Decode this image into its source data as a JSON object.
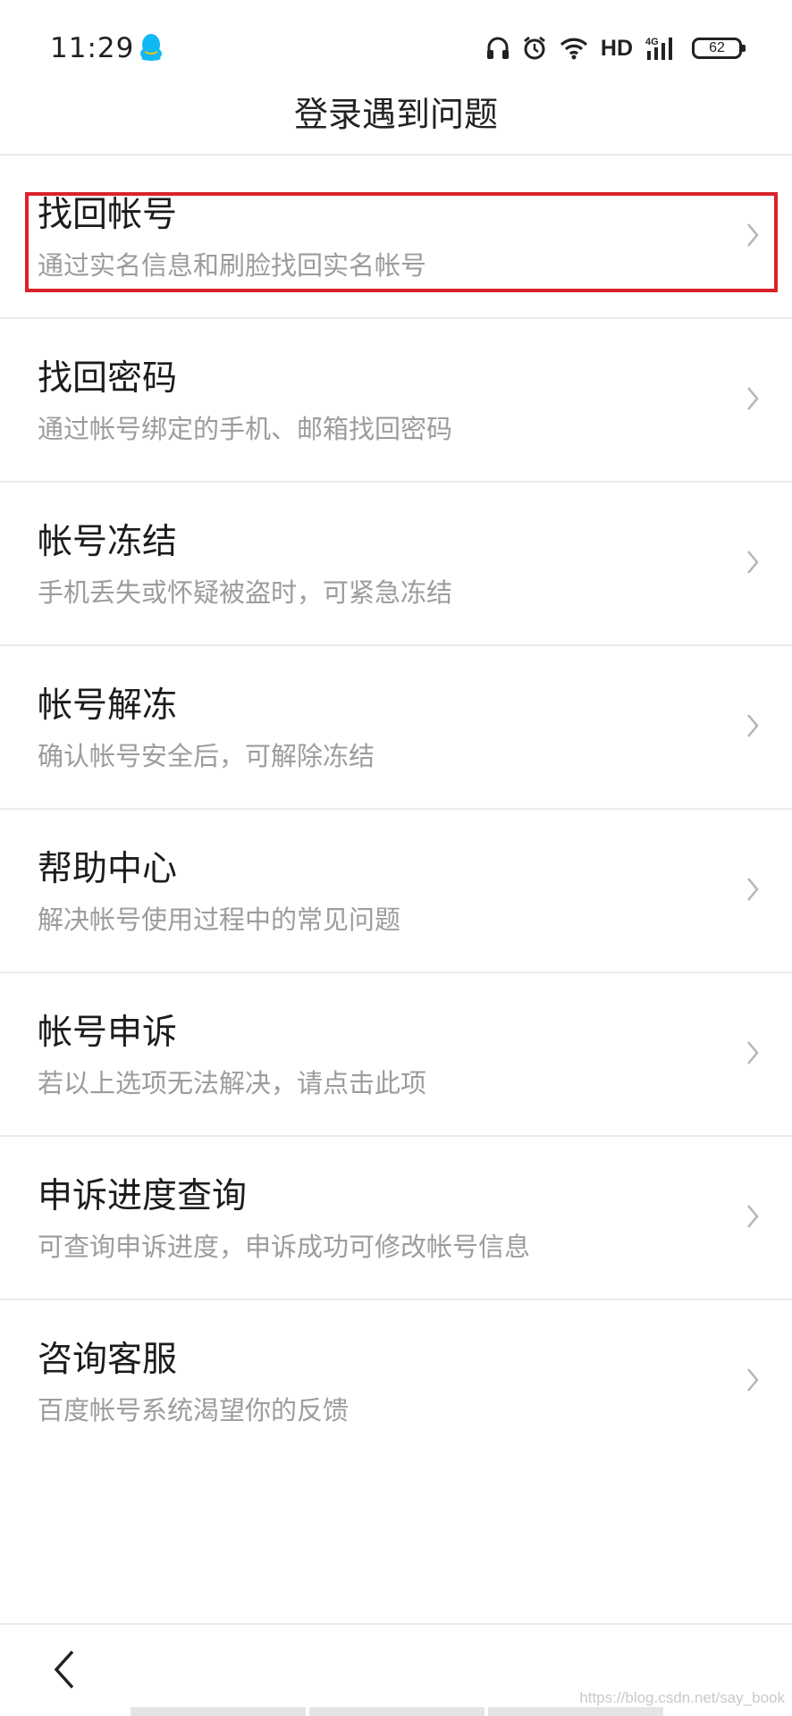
{
  "status_bar": {
    "time": "11:29",
    "network_label": "HD",
    "cellular_label": "4G",
    "battery_level": "62",
    "icons": [
      "qq-icon",
      "headphone-icon",
      "alarm-icon",
      "wifi-icon",
      "signal-icon",
      "battery-icon"
    ]
  },
  "header": {
    "title": "登录遇到问题"
  },
  "menu": {
    "items": [
      {
        "title": "找回帐号",
        "subtitle": "通过实名信息和刷脸找回实名帐号",
        "highlighted": true
      },
      {
        "title": "找回密码",
        "subtitle": "通过帐号绑定的手机、邮箱找回密码"
      },
      {
        "title": "帐号冻结",
        "subtitle": "手机丢失或怀疑被盗时，可紧急冻结"
      },
      {
        "title": "帐号解冻",
        "subtitle": "确认帐号安全后，可解除冻结"
      },
      {
        "title": "帮助中心",
        "subtitle": "解决帐号使用过程中的常见问题"
      },
      {
        "title": "帐号申诉",
        "subtitle": "若以上选项无法解决，请点击此项"
      },
      {
        "title": "申诉进度查询",
        "subtitle": "可查询申诉进度，申诉成功可修改帐号信息"
      },
      {
        "title": "咨询客服",
        "subtitle": "百度帐号系统渴望你的反馈"
      }
    ]
  },
  "watermark": "https://blog.csdn.net/say_book",
  "colors": {
    "highlight": "#d9222a",
    "qq_blue": "#12b7f5",
    "subtitle": "#9c9c9c",
    "divider": "#ececec"
  }
}
